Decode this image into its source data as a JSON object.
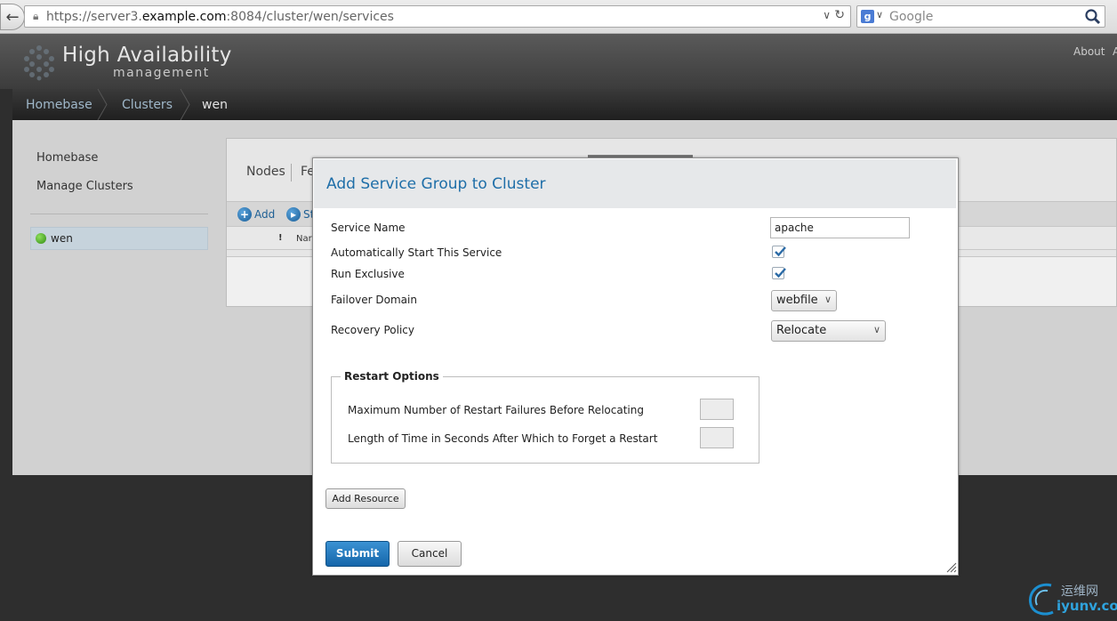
{
  "browser": {
    "url_prefix": "https://server3.",
    "url_host": "example.com",
    "url_suffix": ":8084/cluster/wen/services",
    "search_placeholder": "Google",
    "search_engine_letter": "g"
  },
  "header": {
    "title": "High Availability",
    "subtitle": "management",
    "about": "About",
    "extra": "A"
  },
  "breadcrumb": [
    "Homebase",
    "Clusters",
    "wen"
  ],
  "sidebar": {
    "links": [
      "Homebase",
      "Manage Clusters"
    ],
    "cluster": "wen"
  },
  "content": {
    "tabs": [
      "Nodes",
      "Fe"
    ],
    "toolbar": {
      "add": "Add",
      "start": "St"
    },
    "columns": {
      "bang": "!",
      "name": "Nar"
    }
  },
  "modal": {
    "title": "Add Service Group to Cluster",
    "labels": {
      "service_name": "Service Name",
      "auto_start": "Automatically Start This Service",
      "run_exclusive": "Run Exclusive",
      "failover_domain": "Failover Domain",
      "recovery_policy": "Recovery Policy"
    },
    "values": {
      "service_name": "apache",
      "auto_start": true,
      "run_exclusive": true,
      "failover_domain": "webfile",
      "recovery_policy": "Relocate"
    },
    "restart_options": {
      "legend": "Restart Options",
      "max_failures_label": "Maximum Number of Restart Failures Before Relocating",
      "forget_time_label": "Length of Time in Seconds After Which to Forget a Restart"
    },
    "buttons": {
      "add_resource": "Add Resource",
      "submit": "Submit",
      "cancel": "Cancel"
    }
  },
  "watermark": {
    "cn": "运维网",
    "en": "iyunv.com"
  },
  "colors": {
    "accent": "#1e6ea8",
    "submit": "#1566aa",
    "status_ok": "#2f8a12"
  }
}
